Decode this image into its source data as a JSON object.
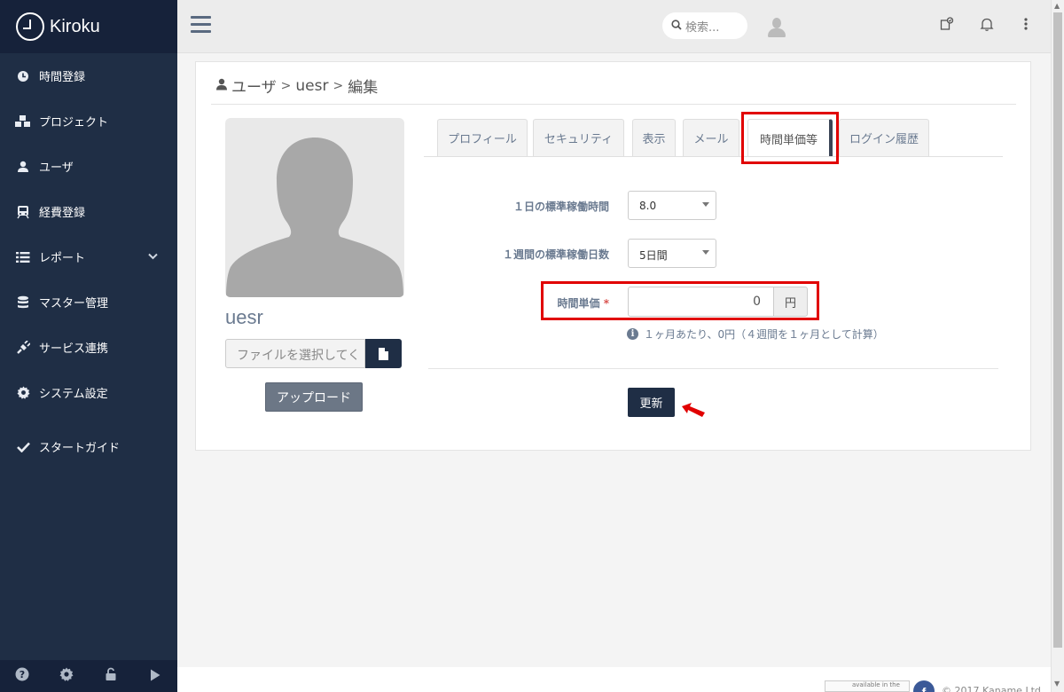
{
  "app": {
    "name": "Kiroku"
  },
  "sidebar": {
    "items": [
      {
        "label": "時間登録",
        "icon": "clock-icon"
      },
      {
        "label": "プロジェクト",
        "icon": "cubes-icon"
      },
      {
        "label": "ユーザ",
        "icon": "user-icon"
      },
      {
        "label": "経費登録",
        "icon": "train-icon"
      },
      {
        "label": "レポート",
        "icon": "list-icon"
      },
      {
        "label": "マスター管理",
        "icon": "database-icon"
      },
      {
        "label": "サービス連携",
        "icon": "plug-icon"
      },
      {
        "label": "システム設定",
        "icon": "gear-icon"
      },
      {
        "label": "スタートガイド",
        "icon": "check-icon"
      }
    ],
    "footer_icons": [
      "help-icon",
      "gear-icon",
      "unlock-icon",
      "play-icon"
    ]
  },
  "topbar": {
    "search_placeholder": "検索..."
  },
  "breadcrumb": {
    "section": "ユーザ",
    "user": "uesr",
    "action": "編集",
    "separator": ">"
  },
  "profile": {
    "username": "uesr",
    "file_placeholder": "ファイルを選択してく",
    "upload_label": "アップロード"
  },
  "tabs": [
    {
      "label": "プロフィール",
      "active": false
    },
    {
      "label": "セキュリティ",
      "active": false
    },
    {
      "label": "表示",
      "active": false
    },
    {
      "label": "メール",
      "active": false
    },
    {
      "label": "時間単価等",
      "active": true
    },
    {
      "label": "ログイン履歴",
      "active": false
    }
  ],
  "form": {
    "daily_hours": {
      "label": "１日の標準稼働時間",
      "value": "8.0"
    },
    "weekly_days": {
      "label": "１週間の標準稼働日数",
      "value": "5日間"
    },
    "hourly_rate": {
      "label": "時間単価",
      "required_mark": "*",
      "value": "0",
      "unit": "円"
    },
    "help_text": "１ヶ月あたり、0円（４週間を１ヶ月として計算）",
    "submit_label": "更新"
  },
  "footer": {
    "badge_text": "available in the",
    "facebook": "f",
    "copyright": "© 2017 Kaname Ltd"
  },
  "colors": {
    "sidebar_bg": "#1f2e45",
    "highlight": "#e10000",
    "primary_button": "#1f2e45"
  }
}
